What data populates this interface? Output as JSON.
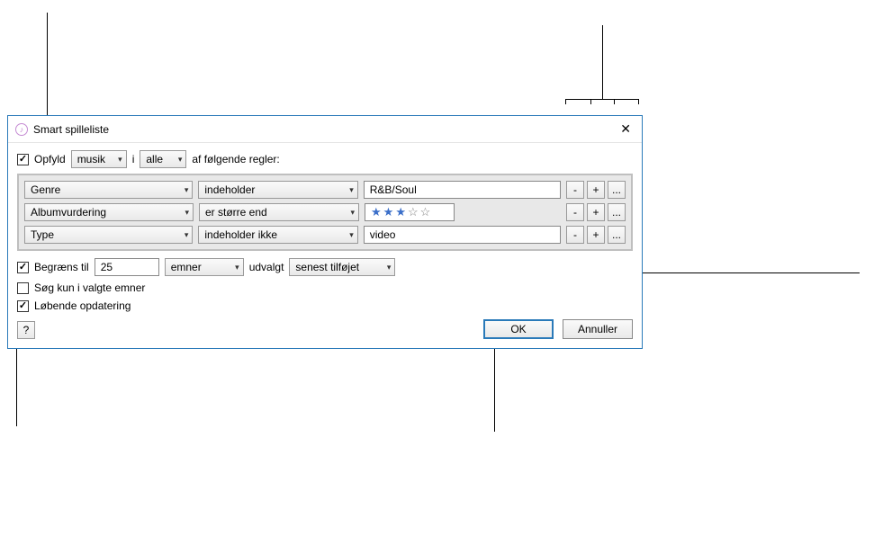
{
  "window": {
    "title": "Smart spilleliste",
    "close_icon": "✕"
  },
  "match": {
    "label": "Opfyld",
    "media_select": "musik",
    "middle_word": "i",
    "scope_select": "alle",
    "suffix": "af følgende regler:"
  },
  "rules": [
    {
      "field": "Genre",
      "op": "indeholder",
      "value": "R&B/Soul",
      "value_kind": "text"
    },
    {
      "field": "Albumvurdering",
      "op": "er større end",
      "value": 3,
      "value_kind": "stars"
    },
    {
      "field": "Type",
      "op": "indeholder ikke",
      "value": "video",
      "value_kind": "text"
    }
  ],
  "rowbuttons": {
    "minus": "-",
    "plus": "+",
    "more": "..."
  },
  "limit": {
    "label": "Begræns til",
    "value": "25",
    "units_select": "emner",
    "middle_word": "udvalgt",
    "sort_select": "senest tilføjet"
  },
  "options": {
    "only_checked": "Søg kun i valgte emner",
    "live_update": "Løbende opdatering"
  },
  "buttons": {
    "help": "?",
    "ok": "OK",
    "cancel": "Annuller"
  }
}
